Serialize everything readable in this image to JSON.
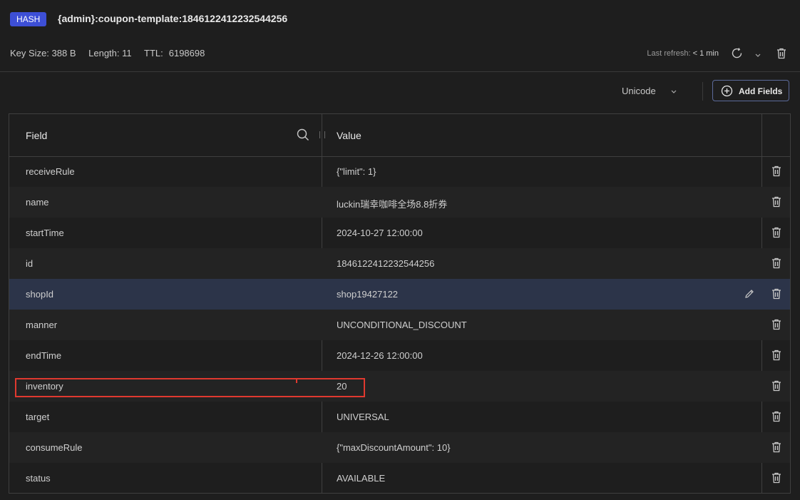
{
  "header": {
    "type_badge": "HASH",
    "key_name": "{admin}:coupon-template:1846122412232544256",
    "key_size": "Key Size: 388 B",
    "length": "Length: 11",
    "ttl_label": "TTL:",
    "ttl_value": "6198698",
    "last_refresh_label": "Last refresh:",
    "last_refresh_value": "< 1 min"
  },
  "toolbar": {
    "encoding": "Unicode",
    "add_fields_label": "Add Fields"
  },
  "table": {
    "columns": [
      "Field",
      "Value"
    ],
    "rows": [
      {
        "field": "receiveRule",
        "value": "{\"limit\": 1}"
      },
      {
        "field": "name",
        "value": "luckin瑞幸咖啡全场8.8折券"
      },
      {
        "field": "startTime",
        "value": "2024-10-27 12:00:00"
      },
      {
        "field": "id",
        "value": "1846122412232544256"
      },
      {
        "field": "shopId",
        "value": "shop19427122"
      },
      {
        "field": "manner",
        "value": "UNCONDITIONAL_DISCOUNT"
      },
      {
        "field": "endTime",
        "value": "2024-12-26 12:00:00"
      },
      {
        "field": "inventory",
        "value": "20"
      },
      {
        "field": "target",
        "value": "UNIVERSAL"
      },
      {
        "field": "consumeRule",
        "value": "{\"maxDiscountAmount\": 10}"
      },
      {
        "field": "status",
        "value": "AVAILABLE"
      }
    ]
  },
  "colors": {
    "badge": "#3d4fd6",
    "selected_row": "#2c3449",
    "highlight_box": "#e0392f"
  }
}
